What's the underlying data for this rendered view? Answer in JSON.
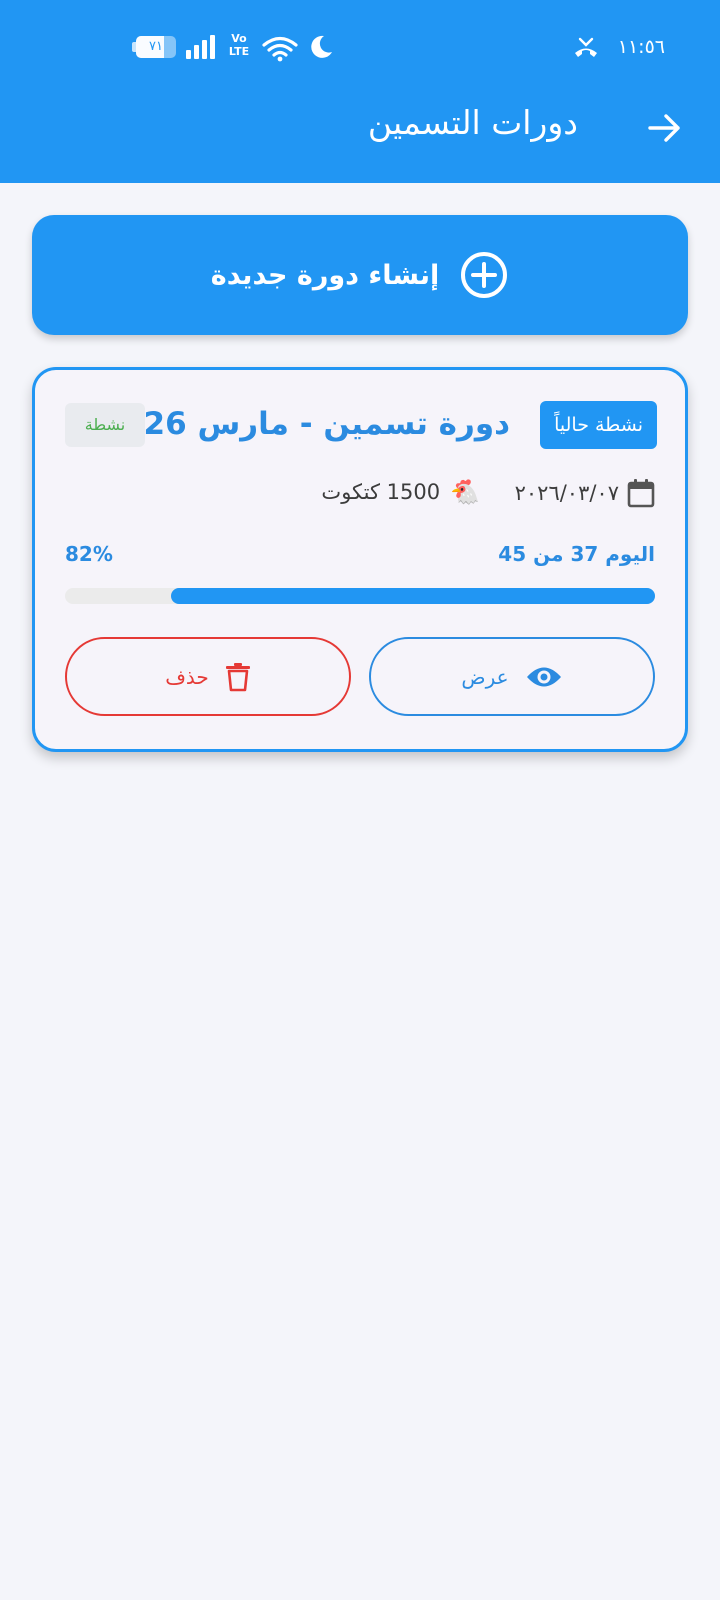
{
  "status_bar": {
    "time": "١١:٥٦",
    "battery_level": "٧١",
    "battery_fraction": 0.71,
    "network_label_top": "Vo",
    "network_label_bottom": "LTE",
    "icons": [
      "phone-missed-icon",
      "moon-icon",
      "wifi-icon",
      "signal-icon",
      "battery-icon"
    ]
  },
  "header": {
    "title": "دورات التسمين",
    "back_icon": "arrow-right-icon"
  },
  "actions": {
    "create_label": "إنشاء دورة جديدة",
    "create_icon": "plus-circle-icon"
  },
  "cycle": {
    "title": "دورة تسمين - مارس 2026",
    "active_badge": "نشطة حالياً",
    "status": "نشطة",
    "date": "٢٠٢٦/٠٣/٠٧",
    "chick_count": "1500 كتكوت",
    "chick_icon": "🐔",
    "day_progress_text": "اليوم 37 من 45",
    "percent_text": "82%",
    "progress": 0.82,
    "view_label": "عرض",
    "delete_label": "حذف"
  },
  "colors": {
    "primary": "#2196f3",
    "primary_text": "#2b8be0",
    "danger": "#e53935",
    "success": "#4caf50",
    "background": "#f4f5fa"
  }
}
